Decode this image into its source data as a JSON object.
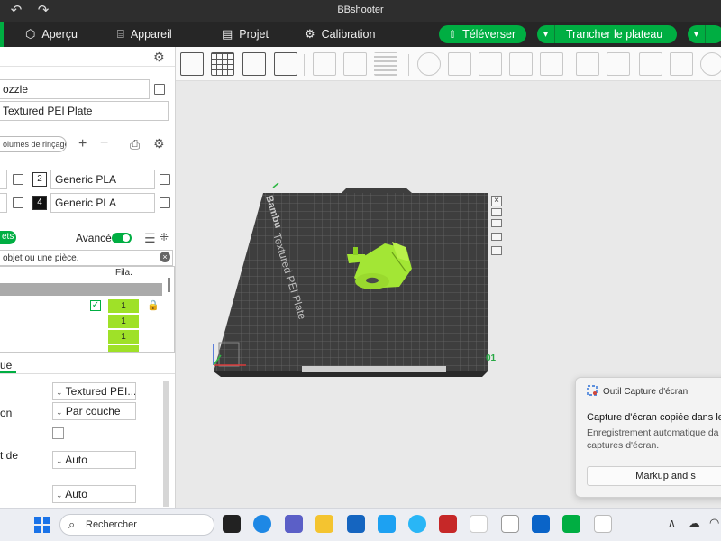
{
  "window": {
    "title": "BBshooter"
  },
  "menubar": {
    "items": [
      {
        "label": "Aperçu",
        "icon": "cube-icon"
      },
      {
        "label": "Appareil",
        "icon": "device-icon"
      },
      {
        "label": "Projet",
        "icon": "folder-icon"
      },
      {
        "label": "Calibration",
        "icon": "calibration-icon"
      }
    ],
    "upload_label": "Téléverser",
    "slice_label": "Trancher le plateau"
  },
  "left": {
    "nozzle_label": "ozzle",
    "plate_value": "Textured PEI Plate",
    "rinse_label": "olumes de rinçage",
    "filaments": [
      {
        "num": "2",
        "name": "Generic PLA"
      },
      {
        "num": "4",
        "name": "Generic PLA"
      }
    ],
    "objects_tab": "ets",
    "advanced_label": "Avancé",
    "search_placeholder": "objet ou une pièce.",
    "fila_header": "Fila.",
    "fila_values": [
      "1",
      "1",
      "1"
    ],
    "lower_tab": "ue",
    "props": {
      "plate_value": "Textured PEI...",
      "row2_label": "on",
      "row2_value": "Par couche",
      "row4_label": "t de",
      "row4_value": "Auto",
      "row5_value": "Auto"
    }
  },
  "viewport": {
    "plate_number": "01",
    "plate_brand": "Bambu",
    "plate_caption": "Textured PEI Plate"
  },
  "toast": {
    "app": "Outil Capture d'écran",
    "title": "Capture d'écran copiée dans le",
    "line1": "Enregistrement automatique da",
    "line2": "captures d'écran.",
    "button": "Markup and s"
  },
  "taskbar": {
    "search": "Rechercher"
  },
  "colors": {
    "accent": "#00ae42",
    "model": "#a3e635"
  }
}
